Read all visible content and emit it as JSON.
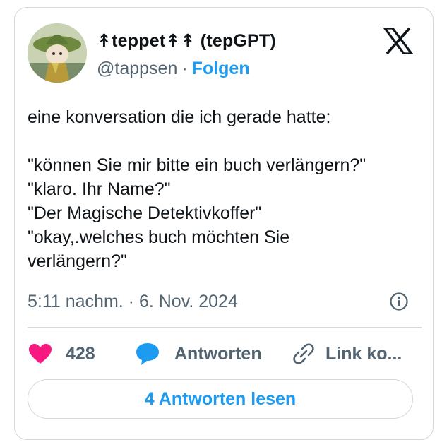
{
  "author": {
    "display_name": "↟teppet↟↟ (tepGPT)",
    "handle": "@tappsen",
    "separator": "·",
    "follow_label": "Folgen"
  },
  "tweet": {
    "text": "eine konversation die ich gerade hatte:\n\n\"können Sie mir bitte ein buch verlängern?\"\n\"klaro. Ihr Name?\"\n\"Der Magische Detektivkoffer\"\n\"okay,.welches buch möchten Sie\nverlängern?\"",
    "timestamp": "5:11 nachm. · 6. Nov. 2024"
  },
  "actions": {
    "like_count": "428",
    "reply_label": "Antworten",
    "link_label": "Link ko..."
  },
  "read_replies_label": "4 Antworten lesen",
  "icons": {
    "logo": "x-logo-icon",
    "info": "info-icon",
    "like": "heart-icon",
    "reply": "speech-bubble-icon",
    "link": "link-icon"
  },
  "colors": {
    "accent": "#1d9bf0",
    "like": "#f91880",
    "secondary_text": "#536471",
    "border": "#cfd9de"
  }
}
